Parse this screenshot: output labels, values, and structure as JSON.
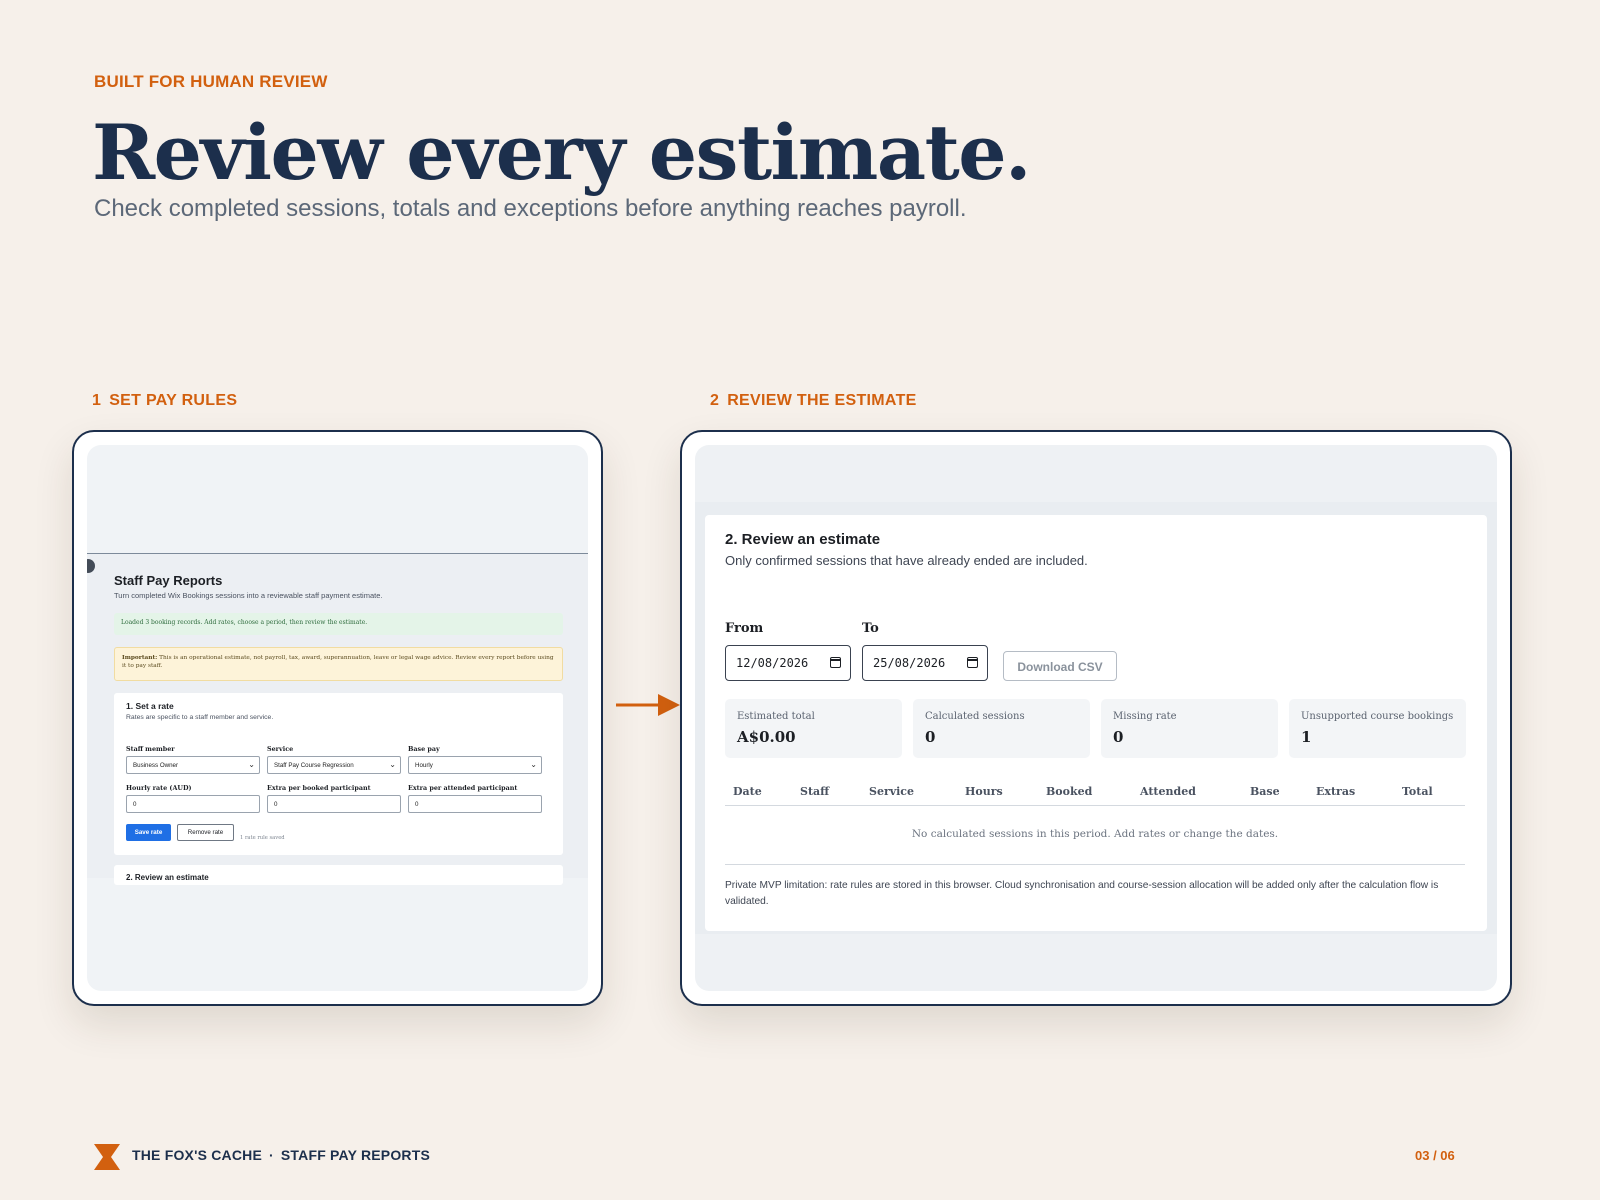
{
  "header": {
    "eyebrow": "BUILT FOR HUMAN REVIEW",
    "headline": "Review every estimate.",
    "subhead": "Check completed sessions, totals and exceptions before anything reaches payroll."
  },
  "steps": [
    {
      "num": "1",
      "label": "SET PAY RULES"
    },
    {
      "num": "2",
      "label": "REVIEW THE ESTIMATE"
    }
  ],
  "left_screen": {
    "app_title": "Staff Pay Reports",
    "app_desc": "Turn completed Wix Bookings sessions into a reviewable staff payment estimate.",
    "success_msg": "Loaded 3 booking records. Add rates, choose a period, then review the estimate.",
    "warning_bold": "Important:",
    "warning_text": "This is an operational estimate, not payroll, tax, award, superannuation, leave or legal wage advice. Review every report before using it to pay staff.",
    "section_title": "1. Set a rate",
    "section_desc": "Rates are specific to a staff member and service.",
    "fields": {
      "staff_label": "Staff member",
      "staff_value": "Business Owner",
      "service_label": "Service",
      "service_value": "Staff Pay Course Regression",
      "base_label": "Base pay",
      "base_value": "Hourly",
      "hourly_label": "Hourly rate (AUD)",
      "hourly_value": "0",
      "booked_label": "Extra per booked participant",
      "booked_value": "0",
      "attended_label": "Extra per attended participant",
      "attended_value": "0"
    },
    "save_label": "Save rate",
    "remove_label": "Remove rate",
    "saved_note": "1 rate rule saved",
    "next_section_title": "2. Review an estimate"
  },
  "right_screen": {
    "title": "2. Review an estimate",
    "desc": "Only confirmed sessions that have already ended are included.",
    "from_label": "From",
    "from_value": "12/08/2026",
    "to_label": "To",
    "to_value": "25/08/2026",
    "download_label": "Download CSV",
    "stats": [
      {
        "label": "Estimated total",
        "value": "A$0.00"
      },
      {
        "label": "Calculated sessions",
        "value": "0"
      },
      {
        "label": "Missing rate",
        "value": "0"
      },
      {
        "label": "Unsupported course bookings",
        "value": "1"
      }
    ],
    "columns": [
      "Date",
      "Staff",
      "Service",
      "Hours",
      "Booked",
      "Attended",
      "Base",
      "Extras",
      "Total"
    ],
    "empty_msg": "No calculated sessions in this period. Add rates or change the dates.",
    "footnote": "Private MVP limitation: rate rules are stored in this browser. Cloud synchronisation and course-session allocation will be added only after the calculation flow is validated."
  },
  "footer": {
    "brand": "THE FOX'S CACHE",
    "separator": "·",
    "product": "STAFF PAY REPORTS",
    "page": "03 / 06"
  },
  "colors": {
    "background": "#f6f0ea",
    "accent": "#d2600f",
    "navy": "#1c2f4c",
    "primary_button": "#1f6fe5"
  },
  "icons": {
    "flow_arrow": "arrow-right-icon",
    "brand_logo": "hourglass-logo-icon",
    "date_picker": "calendar-icon"
  }
}
